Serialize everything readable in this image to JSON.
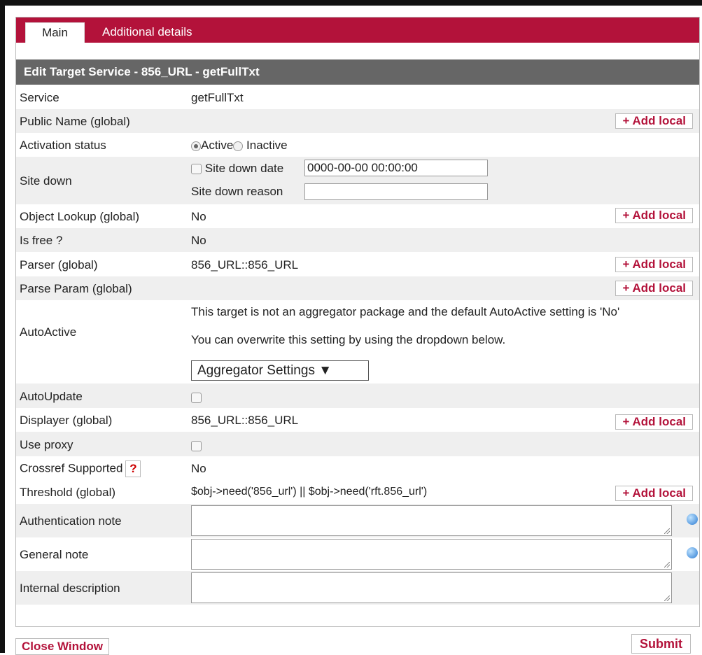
{
  "tabs": [
    {
      "label": "Main"
    },
    {
      "label": "Additional details"
    }
  ],
  "header": {
    "title": "Edit Target Service - 856_URL - getFullTxt"
  },
  "rows": {
    "service": {
      "label": "Service",
      "value": "getFullTxt"
    },
    "public_name": {
      "label": "Public Name (global)",
      "add": "+ Add local"
    },
    "activation": {
      "label": "Activation status",
      "active": "Active",
      "inactive": "Inactive"
    },
    "site_down": {
      "label": "Site down",
      "date_label": "Site down date",
      "date_value": "0000-00-00 00:00:00",
      "reason_label": "Site down reason",
      "reason_value": ""
    },
    "object_lookup": {
      "label": "Object Lookup (global)",
      "value": "No",
      "add": "+ Add local"
    },
    "is_free": {
      "label": "Is free ?",
      "value": "No"
    },
    "parser": {
      "label": "Parser (global)",
      "value": "856_URL::856_URL",
      "add": "+ Add local"
    },
    "parse_param": {
      "label": "Parse Param (global)",
      "add": "+ Add local"
    },
    "autoactive": {
      "label": "AutoActive",
      "line1": "This target is not an aggregator package and the default AutoActive setting is 'No'",
      "line2": "You can overwrite this setting by using the dropdown below.",
      "select": "Aggregator Settings ▼"
    },
    "autoupdate": {
      "label": "AutoUpdate"
    },
    "displayer": {
      "label": "Displayer (global)",
      "value": "856_URL::856_URL",
      "add": "+ Add local"
    },
    "use_proxy": {
      "label": "Use proxy"
    },
    "crossref": {
      "label": "Crossref Supported",
      "help": "?",
      "value": "No"
    },
    "threshold": {
      "label": "Threshold (global)",
      "value": "$obj->need('856_url') || $obj->need('rft.856_url')",
      "add": "+ Add local"
    },
    "auth_note": {
      "label": "Authentication note"
    },
    "general_note": {
      "label": "General note"
    },
    "internal_desc": {
      "label": "Internal description"
    }
  },
  "footer": {
    "close": "Close Window",
    "submit": "Submit"
  }
}
